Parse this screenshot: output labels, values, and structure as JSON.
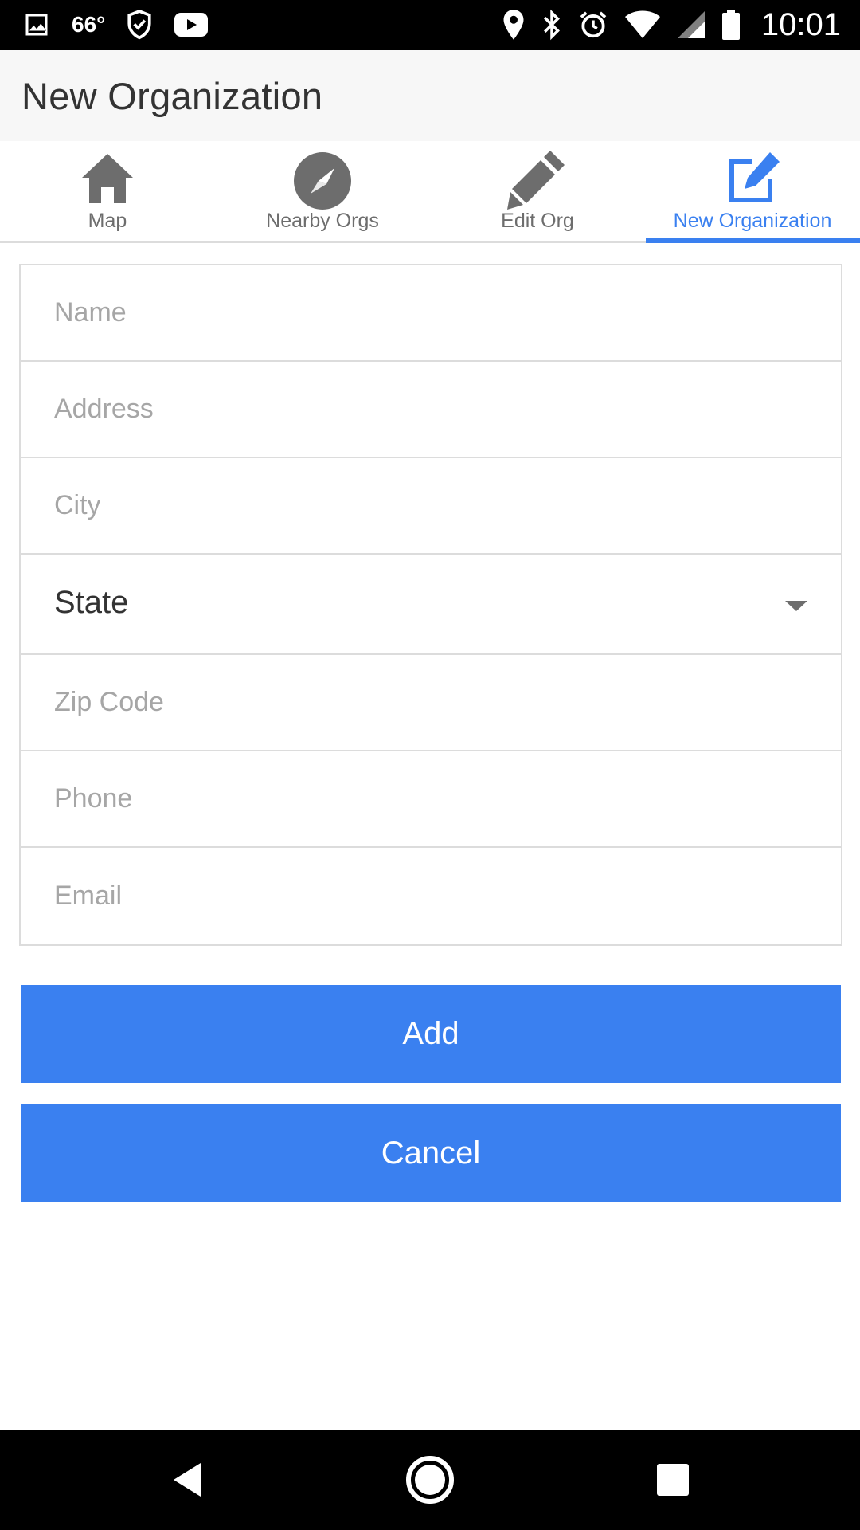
{
  "status_bar": {
    "temperature": "66°",
    "time": "10:01",
    "left_icons": [
      "image-icon",
      "shield-check-icon",
      "youtube-icon"
    ],
    "right_icons": [
      "location-icon",
      "bluetooth-icon",
      "alarm-icon",
      "wifi-icon",
      "signal-icon",
      "battery-icon"
    ]
  },
  "app_bar": {
    "title": "New Organization"
  },
  "tabs": [
    {
      "label": "Map",
      "icon": "home-icon",
      "active": false
    },
    {
      "label": "Nearby Orgs",
      "icon": "compass-icon",
      "active": false
    },
    {
      "label": "Edit Org",
      "icon": "pencil-icon",
      "active": false
    },
    {
      "label": "New Organization",
      "icon": "edit-square-icon",
      "active": true
    }
  ],
  "form": {
    "name_placeholder": "Name",
    "address_placeholder": "Address",
    "city_placeholder": "City",
    "state_value": "State",
    "zip_placeholder": "Zip Code",
    "phone_placeholder": "Phone",
    "email_placeholder": "Email"
  },
  "buttons": {
    "add_label": "Add",
    "cancel_label": "Cancel"
  },
  "nav_bar": {
    "icons": [
      "back-icon",
      "home-circle-icon",
      "recents-icon"
    ]
  },
  "colors": {
    "accent": "#3a80f0",
    "inactive_tab": "#6d6d6d",
    "app_bar_bg": "#f7f7f7",
    "border": "#dcdcdc",
    "placeholder": "#a6a6a6"
  }
}
